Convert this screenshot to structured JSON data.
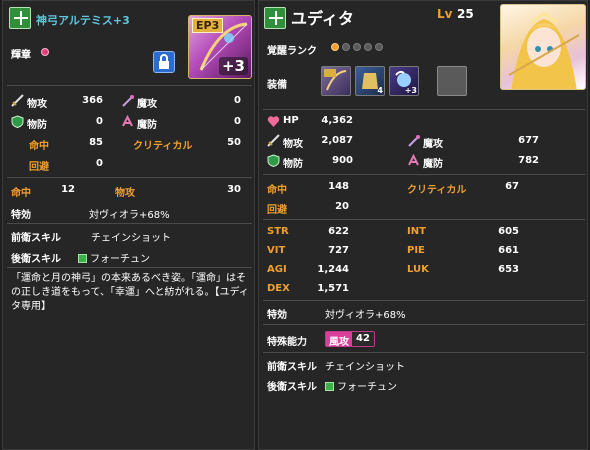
{
  "left": {
    "title": "神弓アルテミス+3",
    "emblem_label": "輝章",
    "lock_icon": "lock-icon",
    "item_badge": "EP3",
    "item_plus": "+3",
    "stats": {
      "patk_label": "物攻",
      "patk": "366",
      "matk_label": "魔攻",
      "matk": "0",
      "pdef_label": "物防",
      "pdef": "0",
      "mdef_label": "魔防",
      "mdef": "0",
      "acc_label": "命中",
      "acc": "85",
      "crit_label": "クリティカル",
      "crit": "50",
      "eva_label": "回避",
      "eva": "0"
    },
    "bonus": {
      "acc_label": "命中",
      "acc": "12",
      "patk_label": "物攻",
      "patk": "30",
      "special_label": "特効",
      "special": "対ヴィオラ+68%"
    },
    "skills": {
      "front_label": "前衛スキル",
      "front": "チェインショット",
      "back_label": "後衛スキル",
      "back": "フォーチュン"
    },
    "description": "「運命と月の神弓」の本来あるべき姿。「運命」はその正しき道をもって、「幸運」へと紡がれる。【ユディタ専用】"
  },
  "right": {
    "name": "ユディタ",
    "lv_label": "Lv",
    "lv": "25",
    "awaken_label": "覚醒ランク",
    "awaken_rank": 1,
    "awaken_max": 5,
    "equip_label": "装備",
    "equip": [
      {
        "name": "equip-slot-1",
        "num": ""
      },
      {
        "name": "equip-slot-2",
        "num": "4"
      },
      {
        "name": "equip-slot-3",
        "num": "+3"
      },
      {
        "name": "equip-slot-4-empty",
        "num": ""
      }
    ],
    "hp_label": "HP",
    "hp": "4,362",
    "patk_label": "物攻",
    "patk": "2,087",
    "matk_label": "魔攻",
    "matk": "677",
    "pdef_label": "物防",
    "pdef": "900",
    "mdef_label": "魔防",
    "mdef": "782",
    "acc_label": "命中",
    "acc": "148",
    "crit_label": "クリティカル",
    "crit": "67",
    "eva_label": "回避",
    "eva": "20",
    "str_label": "STR",
    "str": "622",
    "int_label": "INT",
    "int": "605",
    "vit_label": "VIT",
    "vit": "727",
    "pie_label": "PIE",
    "pie": "661",
    "agi_label": "AGI",
    "agi": "1,244",
    "luk_label": "LUK",
    "luk": "653",
    "dex_label": "DEX",
    "dex": "1,571",
    "special_label": "特効",
    "special": "対ヴィオラ+68%",
    "ability_label": "特殊能力",
    "ability_name": "風攻",
    "ability_value": "42",
    "front_label": "前衛スキル",
    "front": "チェインショット",
    "back_label": "後衛スキル",
    "back": "フォーチュン"
  },
  "colors": {
    "accent_orange": "#f0a030",
    "title_cyan": "#5ec8e0",
    "panel": "#262626"
  }
}
